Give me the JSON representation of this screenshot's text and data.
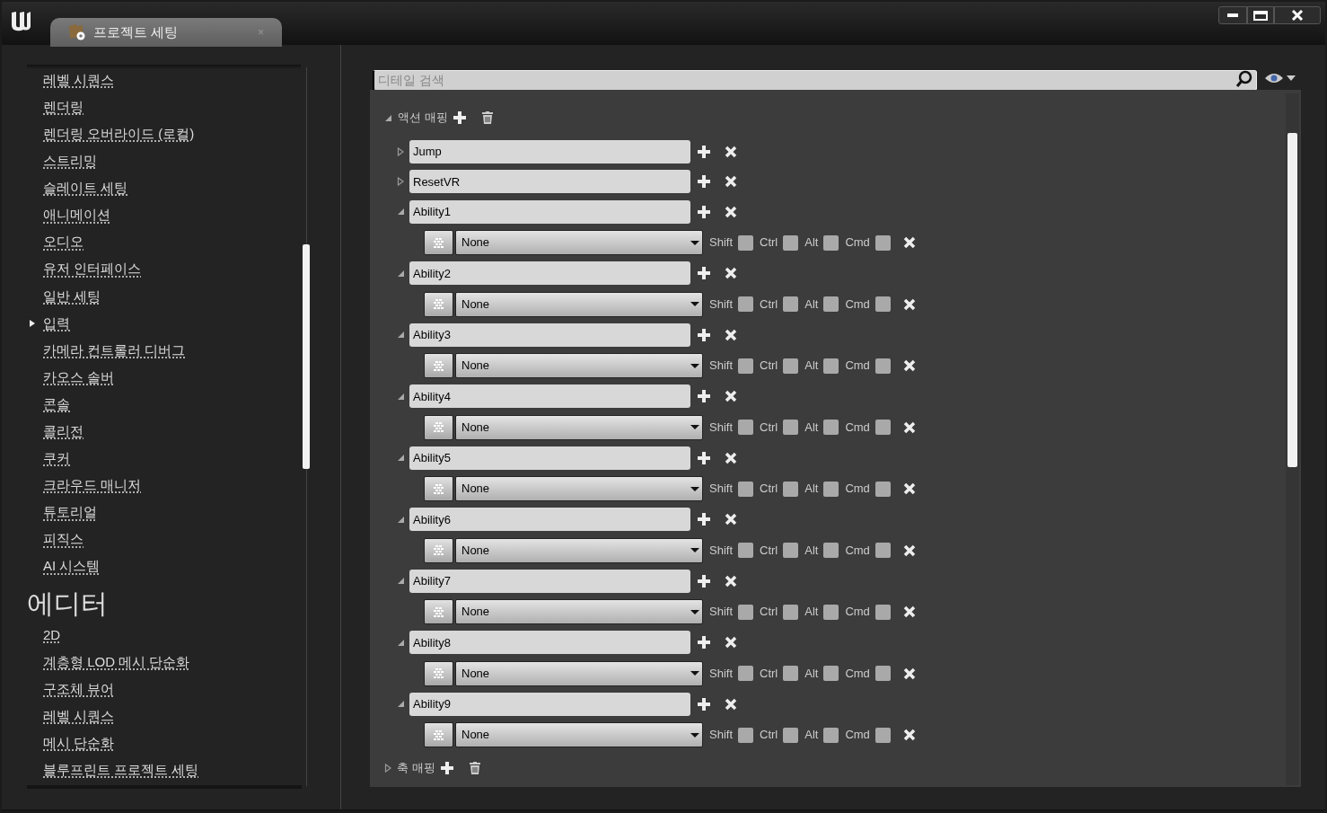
{
  "tab": {
    "title": "프로젝트 세팅",
    "close": "×"
  },
  "sidebar": {
    "sections": [
      {
        "items": [
          {
            "label": "레벨 시퀀스",
            "expandable": false
          },
          {
            "label": "렌더링",
            "expandable": false
          },
          {
            "label": "렌더링 오버라이드 (로컬)",
            "expandable": false
          },
          {
            "label": "스트리밍",
            "expandable": false
          },
          {
            "label": "슬레이트 세팅",
            "expandable": false
          },
          {
            "label": "애니메이션",
            "expandable": false
          },
          {
            "label": "오디오",
            "expandable": false
          },
          {
            "label": "유저 인터페이스",
            "expandable": false
          },
          {
            "label": "일반 세팅",
            "expandable": false
          },
          {
            "label": "입력",
            "expandable": true
          },
          {
            "label": "카메라 컨트롤러 디버그",
            "expandable": false
          },
          {
            "label": "카오스 솔버",
            "expandable": false
          },
          {
            "label": "콘솔",
            "expandable": false
          },
          {
            "label": "콜리전",
            "expandable": false
          },
          {
            "label": "쿠커",
            "expandable": false
          },
          {
            "label": "크라우드 매니저",
            "expandable": false
          },
          {
            "label": "튜토리얼",
            "expandable": false
          },
          {
            "label": "피직스",
            "expandable": false
          },
          {
            "label": "AI 시스템",
            "expandable": false
          }
        ]
      },
      {
        "title": "에디터",
        "items": [
          {
            "label": "2D",
            "expandable": false
          },
          {
            "label": "계층형 LOD 메시 단순화",
            "expandable": false
          },
          {
            "label": "구조체 뷰어",
            "expandable": false
          },
          {
            "label": "레벨 시퀀스",
            "expandable": false
          },
          {
            "label": "메시 단순화",
            "expandable": false
          },
          {
            "label": "블루프린트 프로젝트 세팅",
            "expandable": false
          }
        ]
      }
    ]
  },
  "search": {
    "placeholder": "디테일 검색"
  },
  "action_mappings": {
    "label": "액션 매핑",
    "expanded": true,
    "mappings": [
      {
        "name": "Jump",
        "expanded": false
      },
      {
        "name": "ResetVR",
        "expanded": false
      },
      {
        "name": "Ability1",
        "expanded": true,
        "keys": [
          {
            "key": "None",
            "modifiers": [
              {
                "label": "Shift",
                "checked": false
              },
              {
                "label": "Ctrl",
                "checked": false
              },
              {
                "label": "Alt",
                "checked": false
              },
              {
                "label": "Cmd",
                "checked": false
              }
            ]
          }
        ]
      },
      {
        "name": "Ability2",
        "expanded": true,
        "keys": [
          {
            "key": "None",
            "modifiers": [
              {
                "label": "Shift",
                "checked": false
              },
              {
                "label": "Ctrl",
                "checked": false
              },
              {
                "label": "Alt",
                "checked": false
              },
              {
                "label": "Cmd",
                "checked": false
              }
            ]
          }
        ]
      },
      {
        "name": "Ability3",
        "expanded": true,
        "keys": [
          {
            "key": "None",
            "modifiers": [
              {
                "label": "Shift",
                "checked": false
              },
              {
                "label": "Ctrl",
                "checked": false
              },
              {
                "label": "Alt",
                "checked": false
              },
              {
                "label": "Cmd",
                "checked": false
              }
            ]
          }
        ]
      },
      {
        "name": "Ability4",
        "expanded": true,
        "keys": [
          {
            "key": "None",
            "modifiers": [
              {
                "label": "Shift",
                "checked": false
              },
              {
                "label": "Ctrl",
                "checked": false
              },
              {
                "label": "Alt",
                "checked": false
              },
              {
                "label": "Cmd",
                "checked": false
              }
            ]
          }
        ]
      },
      {
        "name": "Ability5",
        "expanded": true,
        "keys": [
          {
            "key": "None",
            "modifiers": [
              {
                "label": "Shift",
                "checked": false
              },
              {
                "label": "Ctrl",
                "checked": false
              },
              {
                "label": "Alt",
                "checked": false
              },
              {
                "label": "Cmd",
                "checked": false
              }
            ]
          }
        ]
      },
      {
        "name": "Ability6",
        "expanded": true,
        "keys": [
          {
            "key": "None",
            "modifiers": [
              {
                "label": "Shift",
                "checked": false
              },
              {
                "label": "Ctrl",
                "checked": false
              },
              {
                "label": "Alt",
                "checked": false
              },
              {
                "label": "Cmd",
                "checked": false
              }
            ]
          }
        ]
      },
      {
        "name": "Ability7",
        "expanded": true,
        "keys": [
          {
            "key": "None",
            "modifiers": [
              {
                "label": "Shift",
                "checked": false
              },
              {
                "label": "Ctrl",
                "checked": false
              },
              {
                "label": "Alt",
                "checked": false
              },
              {
                "label": "Cmd",
                "checked": false
              }
            ]
          }
        ]
      },
      {
        "name": "Ability8",
        "expanded": true,
        "keys": [
          {
            "key": "None",
            "modifiers": [
              {
                "label": "Shift",
                "checked": false
              },
              {
                "label": "Ctrl",
                "checked": false
              },
              {
                "label": "Alt",
                "checked": false
              },
              {
                "label": "Cmd",
                "checked": false
              }
            ]
          }
        ]
      },
      {
        "name": "Ability9",
        "expanded": true,
        "keys": [
          {
            "key": "None",
            "modifiers": [
              {
                "label": "Shift",
                "checked": false
              },
              {
                "label": "Ctrl",
                "checked": false
              },
              {
                "label": "Alt",
                "checked": false
              },
              {
                "label": "Cmd",
                "checked": false
              }
            ]
          }
        ]
      }
    ]
  },
  "axis_mappings": {
    "label": "축 매핑",
    "expanded": false
  }
}
